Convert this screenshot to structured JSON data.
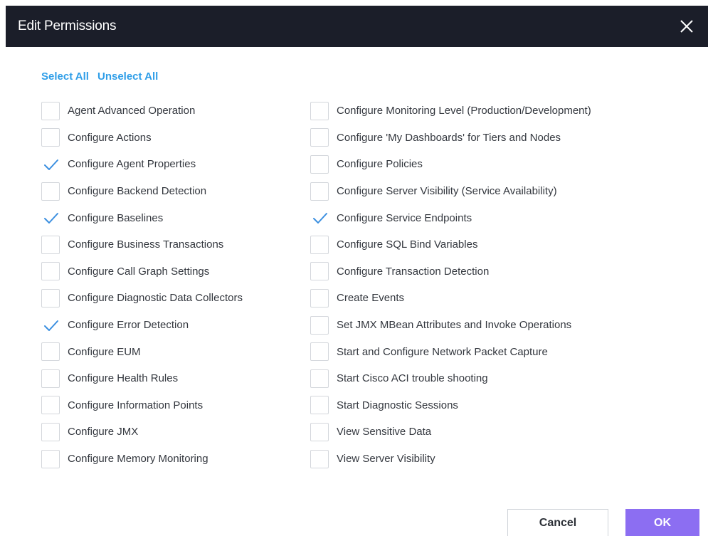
{
  "dialog": {
    "title": "Edit Permissions",
    "close_icon": "close-icon"
  },
  "links": {
    "select_all": "Select All",
    "unselect_all": "Unselect All"
  },
  "colors": {
    "titlebar": "#1b1e29",
    "link": "#2f9ee8",
    "checkmark": "#3b8fe0",
    "ok_button": "#8c6ef2"
  },
  "permissions": {
    "left": [
      {
        "label": "Agent Advanced Operation",
        "checked": false
      },
      {
        "label": "Configure Actions",
        "checked": false
      },
      {
        "label": "Configure Agent Properties",
        "checked": true
      },
      {
        "label": "Configure Backend Detection",
        "checked": false
      },
      {
        "label": "Configure Baselines",
        "checked": true
      },
      {
        "label": "Configure Business Transactions",
        "checked": false
      },
      {
        "label": "Configure Call Graph Settings",
        "checked": false
      },
      {
        "label": "Configure Diagnostic Data Collectors",
        "checked": false
      },
      {
        "label": "Configure Error Detection",
        "checked": true
      },
      {
        "label": "Configure EUM",
        "checked": false
      },
      {
        "label": "Configure Health Rules",
        "checked": false
      },
      {
        "label": "Configure Information Points",
        "checked": false
      },
      {
        "label": "Configure JMX",
        "checked": false
      },
      {
        "label": "Configure Memory Monitoring",
        "checked": false
      }
    ],
    "right": [
      {
        "label": "Configure Monitoring Level (Production/Development)",
        "checked": false
      },
      {
        "label": "Configure 'My Dashboards' for Tiers and Nodes",
        "checked": false
      },
      {
        "label": "Configure Policies",
        "checked": false
      },
      {
        "label": "Configure Server Visibility (Service Availability)",
        "checked": false
      },
      {
        "label": "Configure Service Endpoints",
        "checked": true
      },
      {
        "label": "Configure SQL Bind Variables",
        "checked": false
      },
      {
        "label": "Configure Transaction Detection",
        "checked": false
      },
      {
        "label": "Create Events",
        "checked": false
      },
      {
        "label": "Set JMX MBean Attributes and Invoke Operations",
        "checked": false
      },
      {
        "label": "Start and Configure Network Packet Capture",
        "checked": false
      },
      {
        "label": "Start Cisco ACI trouble shooting",
        "checked": false
      },
      {
        "label": "Start Diagnostic Sessions",
        "checked": false
      },
      {
        "label": "View Sensitive Data",
        "checked": false
      },
      {
        "label": "View Server Visibility",
        "checked": false
      }
    ]
  },
  "footer": {
    "cancel_label": "Cancel",
    "ok_label": "OK"
  }
}
